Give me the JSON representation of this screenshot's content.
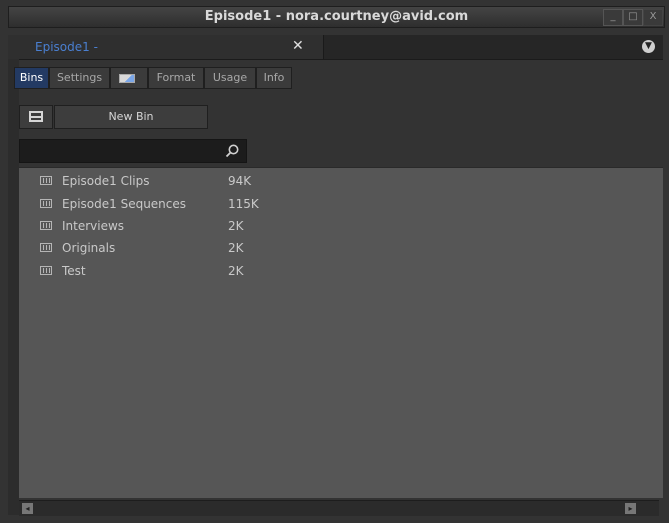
{
  "window": {
    "title": "Episode1 - nora.courtney@avid.com",
    "controls": {
      "minimize": "_",
      "maximize": "□",
      "close": "X"
    }
  },
  "tabbar": {
    "doc_tab_label": "Episode1 -",
    "close_label": "✕",
    "menu_label": "▼"
  },
  "panel_tabs": [
    {
      "label": "Bins",
      "active": true
    },
    {
      "label": "Settings",
      "active": false
    },
    {
      "label": "",
      "icon": "display-icon",
      "active": false
    },
    {
      "label": "Format",
      "active": false
    },
    {
      "label": "Usage",
      "active": false
    },
    {
      "label": "Info",
      "active": false
    }
  ],
  "toolbar": {
    "view_icon": "bin-view-icon",
    "new_bin_label": "New Bin"
  },
  "search": {
    "value": "",
    "placeholder": "",
    "icon": "search-icon"
  },
  "bins": [
    {
      "name": "Episode1 Clips",
      "size": "94K"
    },
    {
      "name": "Episode1 Sequences",
      "size": "115K"
    },
    {
      "name": "Interviews",
      "size": "2K"
    },
    {
      "name": "Originals",
      "size": "2K"
    },
    {
      "name": "Test",
      "size": "2K"
    }
  ],
  "scrollbar": {
    "left_arrow": "◂",
    "right_arrow": "▸"
  },
  "colors": {
    "active_tab": "#233a63",
    "accent_text": "#4a7fd0",
    "list_bg": "#565656"
  }
}
